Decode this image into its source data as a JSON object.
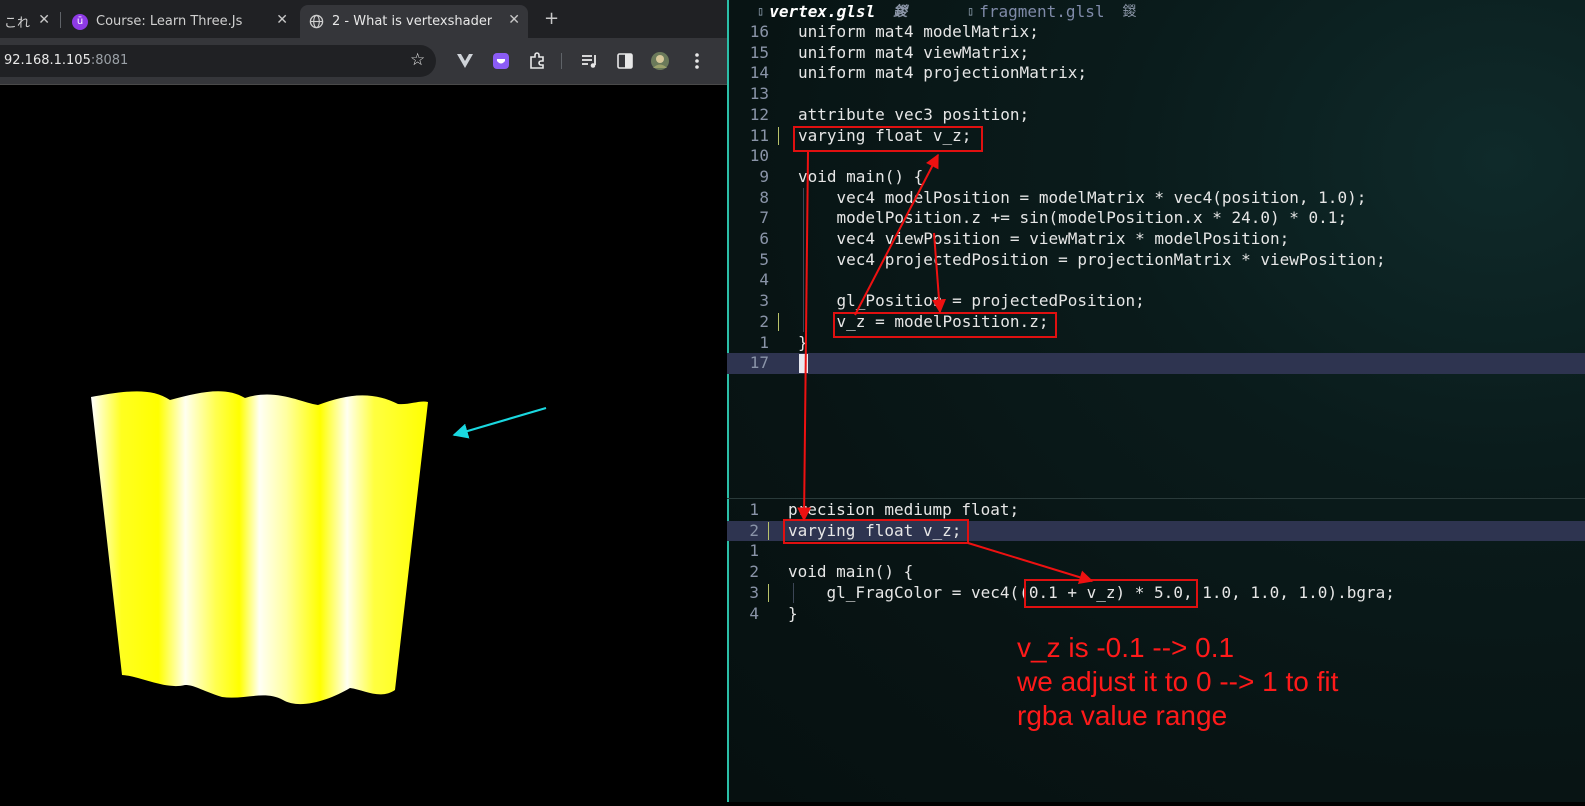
{
  "browser": {
    "tabs": [
      {
        "title": "これ",
        "close": "✕"
      },
      {
        "title": "Course: Learn Three.Js a",
        "close": "✕"
      },
      {
        "title": "2 - What is vertexshader",
        "close": "✕"
      }
    ],
    "new_tab": "+",
    "url_host": "92.168.1.105",
    "url_port": ":8081",
    "star_icon": "☆"
  },
  "editor": {
    "tabs": [
      {
        "name": "vertex.glsl",
        "modified": "鍐"
      },
      {
        "name": "fragment.glsl",
        "modified": "鍐"
      }
    ],
    "vertex_lines": [
      {
        "n": "16",
        "t": "uniform mat4 modelMatrix;"
      },
      {
        "n": "15",
        "t": "uniform mat4 viewMatrix;"
      },
      {
        "n": "14",
        "t": "uniform mat4 projectionMatrix;"
      },
      {
        "n": "13",
        "t": ""
      },
      {
        "n": "12",
        "t": "attribute vec3 position;"
      },
      {
        "n": "11",
        "t": "varying float v_z;"
      },
      {
        "n": "10",
        "t": ""
      },
      {
        "n": "9",
        "t": "void main() {"
      },
      {
        "n": "8",
        "t": "    vec4 modelPosition = modelMatrix * vec4(position, 1.0);"
      },
      {
        "n": "7",
        "t": "    modelPosition.z += sin(modelPosition.x * 24.0) * 0.1;"
      },
      {
        "n": "6",
        "t": "    vec4 viewPosition = viewMatrix * modelPosition;"
      },
      {
        "n": "5",
        "t": "    vec4 projectedPosition = projectionMatrix * viewPosition;"
      },
      {
        "n": "4",
        "t": ""
      },
      {
        "n": "3",
        "t": "    gl_Position = projectedPosition;"
      },
      {
        "n": "2",
        "t": "    v_z = modelPosition.z;"
      },
      {
        "n": "1",
        "t": "}"
      },
      {
        "n": "17",
        "t": ""
      }
    ],
    "fragment_lines": [
      {
        "n": "1",
        "t": "precision mediump float;"
      },
      {
        "n": "2",
        "t": "varying float v_z;"
      },
      {
        "n": "1",
        "t": ""
      },
      {
        "n": "2",
        "t": "void main() {"
      },
      {
        "n": "3",
        "t": "    gl_FragColor = vec4((0.1 + v_z) * 5.0, 1.0, 1.0, 1.0).bgra;"
      },
      {
        "n": "4",
        "t": "}"
      }
    ]
  },
  "annotation": {
    "lines": [
      "v_z is -0.1 --> 0.1",
      "we adjust it to 0 --> 1 to fit",
      "rgba value range"
    ]
  },
  "colors": {
    "annotation_red": "#ff1a1a",
    "pointer_cyan": "#1ad8e0",
    "shader_yellow": "#ffff00"
  }
}
